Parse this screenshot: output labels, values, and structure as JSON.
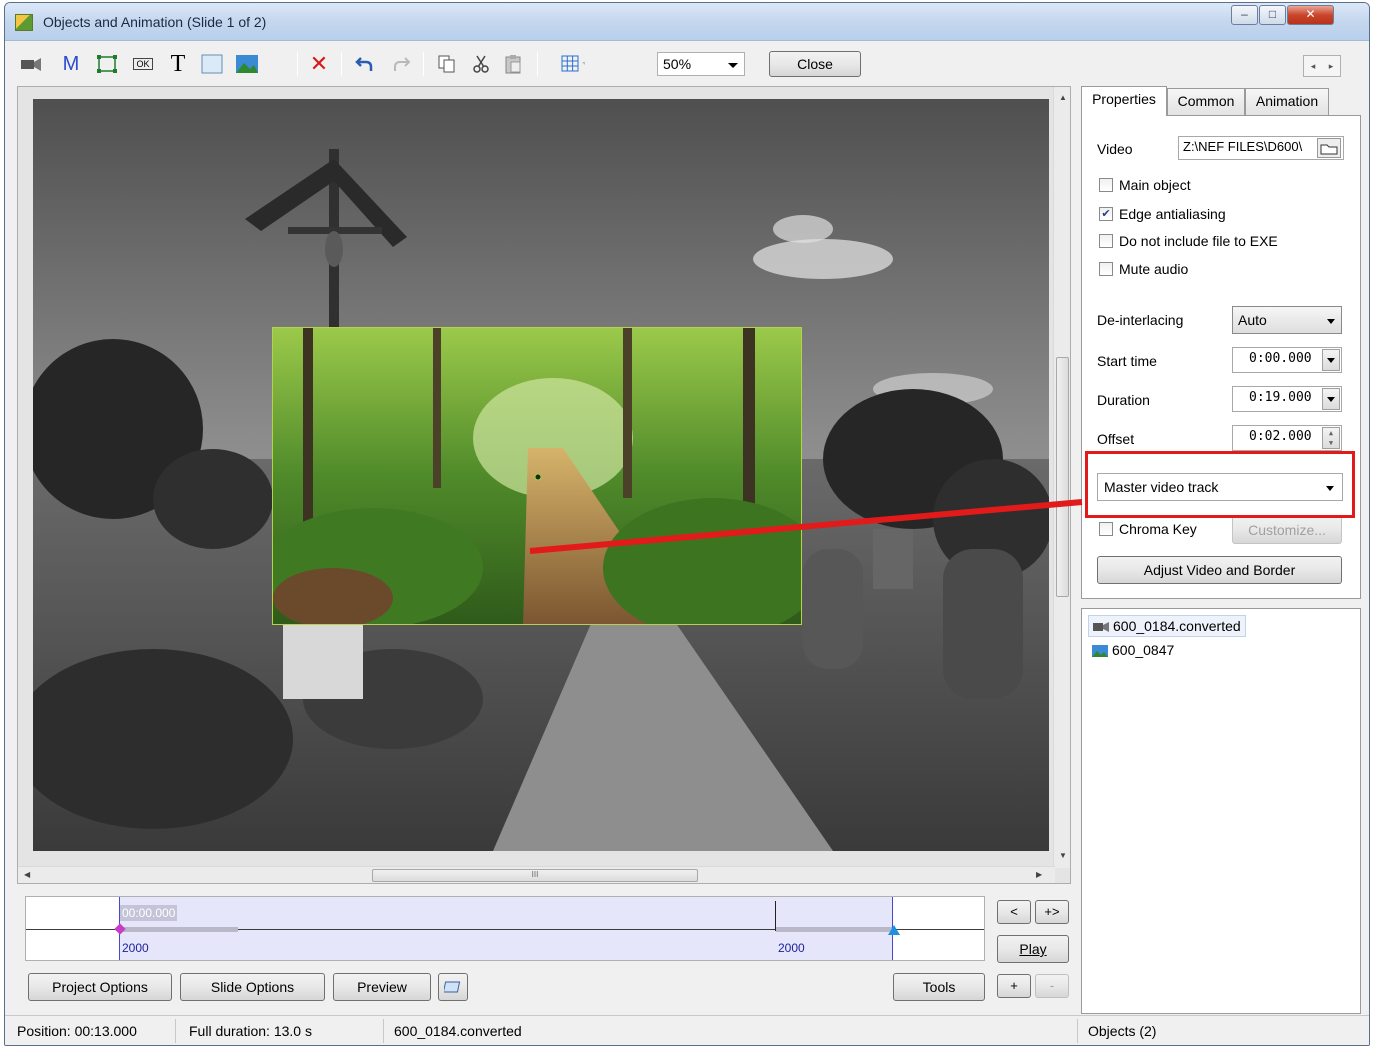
{
  "window": {
    "title": "Objects and Animation  (Slide 1 of 2)",
    "min_glyph": "–",
    "max_glyph": "□",
    "close_glyph": "✕"
  },
  "toolbar": {
    "icons": [
      "video-icon",
      "mask-icon",
      "frame-icon",
      "button-icon",
      "text-icon",
      "rectangle-icon",
      "image-icon",
      "delete-icon",
      "undo-icon",
      "redo-icon",
      "copy-icon",
      "cut-icon",
      "paste-icon",
      "grid-icon"
    ],
    "mask_glyph": "M",
    "text_glyph": "T",
    "button_glyph": "OK",
    "delete_glyph": "✕",
    "zoom": "50%",
    "close_label": "Close"
  },
  "timeline": {
    "current_time": "00:00.000",
    "start_label": "2000",
    "end_label": "2000"
  },
  "timeline_controls": {
    "prev_label": "<",
    "next_label": "+>",
    "play_label": "Play",
    "add_label": "+",
    "remove_label": "-"
  },
  "bottom_buttons": {
    "project_options": "Project Options",
    "slide_options": "Slide Options",
    "preview": "Preview",
    "tools": "Tools"
  },
  "tabs": [
    {
      "label": "Properties",
      "active": true
    },
    {
      "label": "Common",
      "active": false
    },
    {
      "label": "Animation",
      "active": false
    }
  ],
  "properties": {
    "video_label": "Video",
    "video_path": "Z:\\NEF FILES\\D600\\",
    "main_object": {
      "label": "Main object",
      "checked": false
    },
    "edge_antialiasing": {
      "label": "Edge antialiasing",
      "checked": true
    },
    "not_include_exe": {
      "label": "Do not include file to EXE",
      "checked": false
    },
    "mute_audio": {
      "label": "Mute audio",
      "checked": false
    },
    "deinterlacing_label": "De-interlacing",
    "deinterlacing_value": "Auto",
    "start_time_label": "Start time",
    "start_time_value": "0:00.000",
    "duration_label": "Duration",
    "duration_value": "0:19.000",
    "offset_label": "Offset",
    "offset_value": "0:02.000",
    "track_value": "Master video track",
    "chroma_key": {
      "label": "Chroma Key",
      "checked": false
    },
    "customize_label": "Customize...",
    "adjust_label": "Adjust Video and Border",
    "highlight_color": "#e21a1a"
  },
  "objects": [
    {
      "name": "600_0184.converted",
      "icon": "video-icon",
      "selected": true
    },
    {
      "name": "600_0847",
      "icon": "image-icon",
      "selected": false
    }
  ],
  "status": {
    "position": "Position:  00:13.000",
    "full_duration": "Full duration:  13.0 s",
    "object": "600_0184.converted",
    "objects_count": "Objects (2)"
  },
  "scrollbar": {
    "grip": "III"
  }
}
